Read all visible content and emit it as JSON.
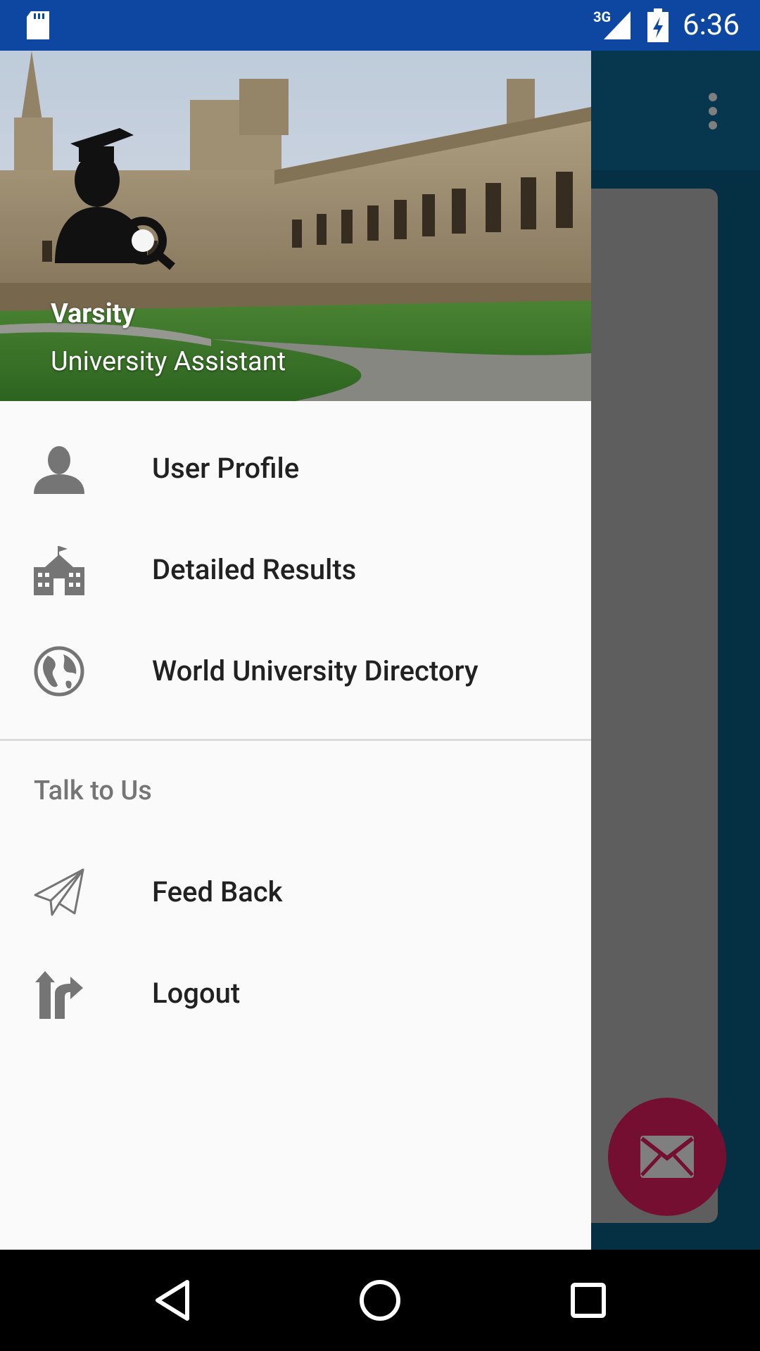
{
  "status_bar": {
    "network_type": "3G",
    "time": "6:36",
    "icons": [
      "sd-card-icon",
      "signal-icon",
      "battery-charging-icon"
    ]
  },
  "drawer": {
    "header": {
      "title": "Varsity",
      "subtitle": "University Assistant",
      "logo_icon": "graduate-search-logo",
      "background": "university-quad-photo"
    },
    "items": [
      {
        "label": "User Profile",
        "icon": "user-icon"
      },
      {
        "label": "Detailed Results",
        "icon": "school-building-icon"
      },
      {
        "label": "World University Directory",
        "icon": "globe-icon"
      }
    ],
    "section": {
      "title": "Talk to Us",
      "items": [
        {
          "label": "Feed Back",
          "icon": "paper-plane-icon"
        },
        {
          "label": "Logout",
          "icon": "logout-icon"
        }
      ]
    }
  },
  "background_app": {
    "fab_icon": "mail-icon",
    "toolbar_icon": "more-vert-icon"
  },
  "nav_bar": {
    "buttons": [
      "back-icon",
      "home-icon",
      "recents-icon"
    ]
  },
  "colors": {
    "status_bar": "#0d47a1",
    "accent": "#e91e63",
    "primary": "#0d6e9c",
    "drawer_bg": "#fafafa",
    "icon_gray": "#757575"
  }
}
